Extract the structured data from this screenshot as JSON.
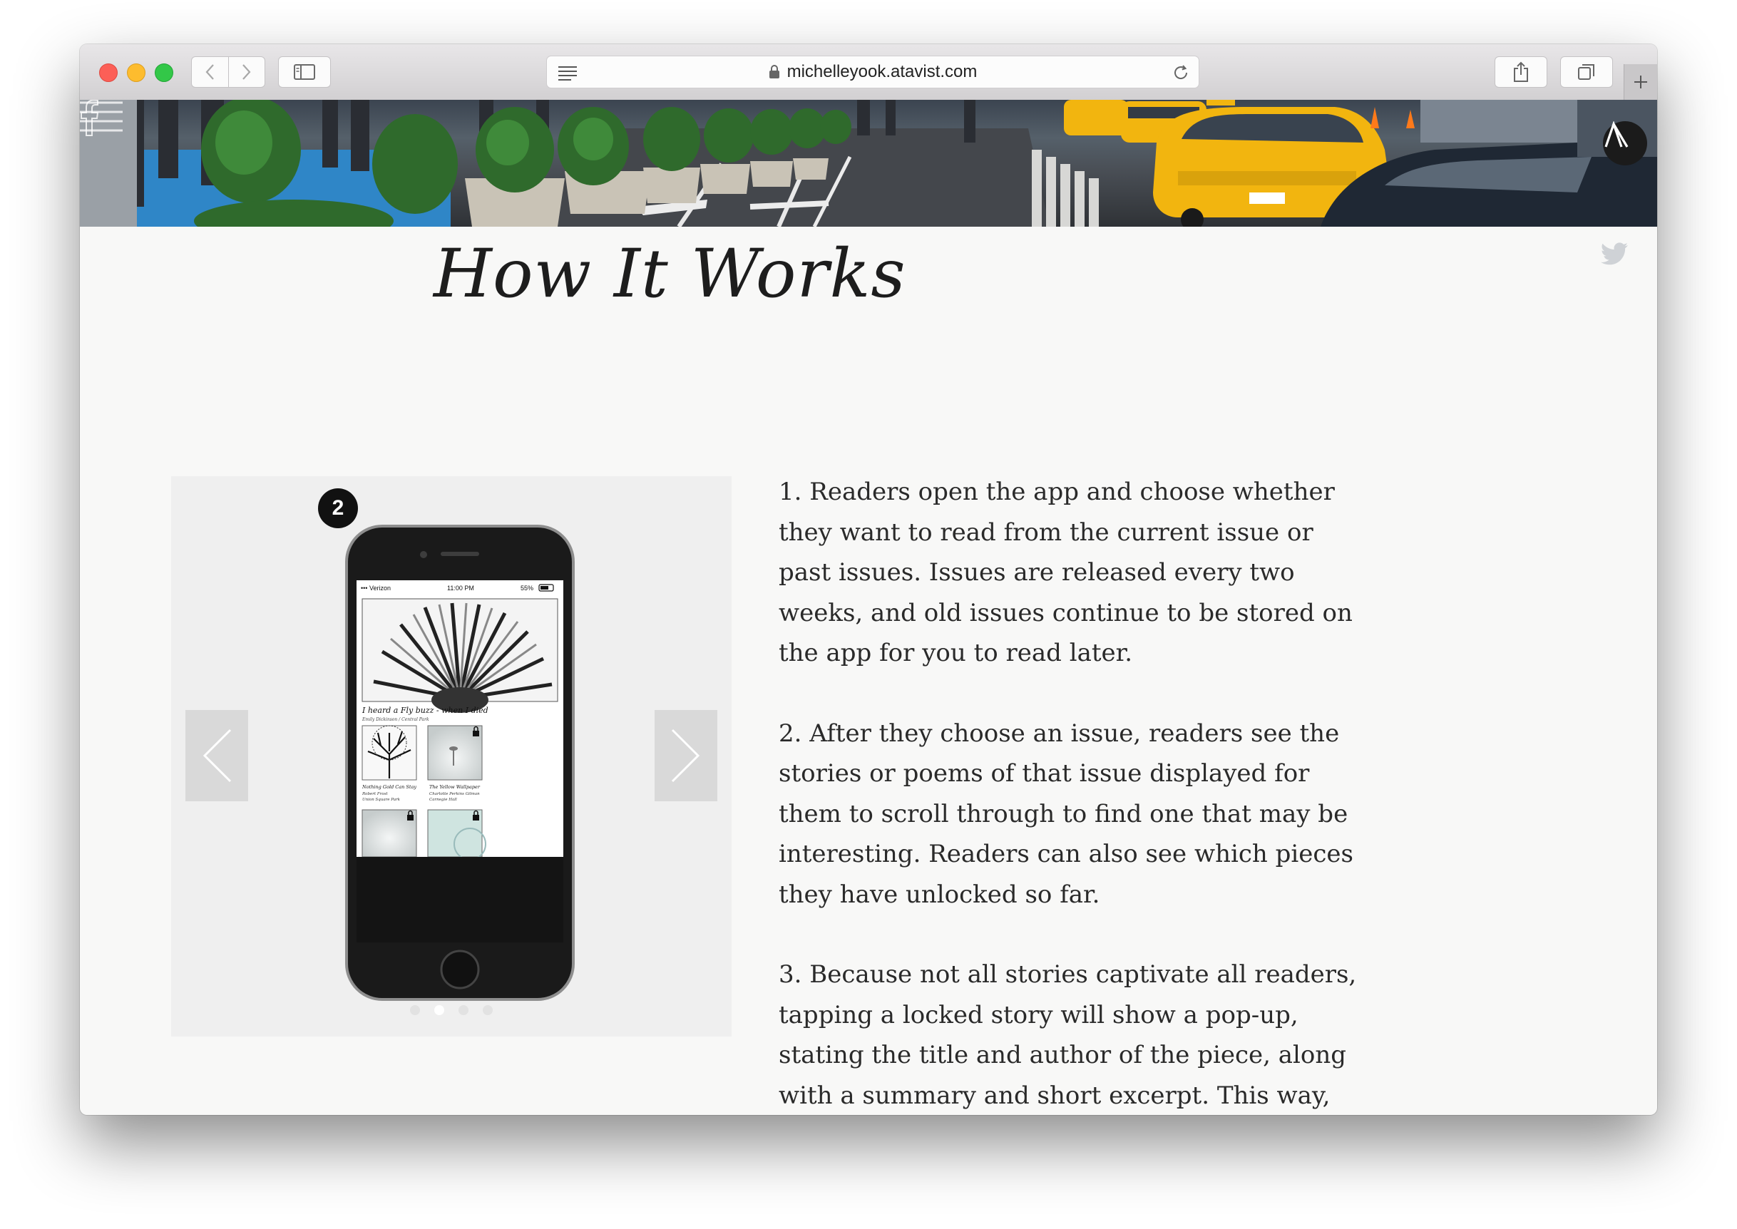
{
  "browser": {
    "url": "michelleyook.atavist.com",
    "buttons": {
      "back": "chevron-left-icon",
      "forward": "chevron-right-icon",
      "sidebar": "sidebar-icon",
      "reader": "reader-icon",
      "reload": "reload-icon",
      "share": "share-icon",
      "tabs": "tabs-icon",
      "new_tab": "plus-icon"
    }
  },
  "header": {
    "menu_icon": "hamburger-menu-icon",
    "logo_icon": "atavist-logo-icon",
    "social": [
      "facebook-icon",
      "twitter-icon"
    ]
  },
  "main": {
    "title": "How It Works",
    "carousel": {
      "step_number": "2",
      "prev_icon": "chevron-left-icon",
      "next_icon": "chevron-right-icon",
      "slide_count": 4,
      "active_index": 1,
      "phone_screen": {
        "carrier": "••• Verizon",
        "time": "11:00 PM",
        "battery": "55%",
        "featured_title": "I heard a Fly buzz - when I died",
        "featured_subtitle": "Emily Dickinson / Central Park",
        "tiles": [
          {
            "title": "Nothing Gold Can Stay",
            "author": "Robert Frost",
            "place": "Union Square Park",
            "locked": false
          },
          {
            "title": "The Yellow Wallpaper",
            "author": "Charlotte Perkins Gilman",
            "place": "Carnegie Hall",
            "locked": true
          }
        ]
      }
    },
    "paragraphs": [
      "1. Readers open the app and choose whether they want to read from the current issue or past issues. Issues are released every two weeks, and old issues continue to be stored on the app for you to read later.",
      "2. After they choose an issue, readers see the stories or poems of that issue displayed for them to scroll through to find one that may be interesting. Readers can also see which pieces they have unlocked so far.",
      "3. Because not all stories captivate all readers, tapping a locked story will show a pop-up, stating the title and author of the piece, along with a summary and short excerpt. This way,"
    ]
  },
  "colors": {
    "page_bg": "#f8f8f7",
    "carousel_bg": "#efefef",
    "text": "#2a2a2a",
    "taxi_yellow": "#f2b50f"
  }
}
